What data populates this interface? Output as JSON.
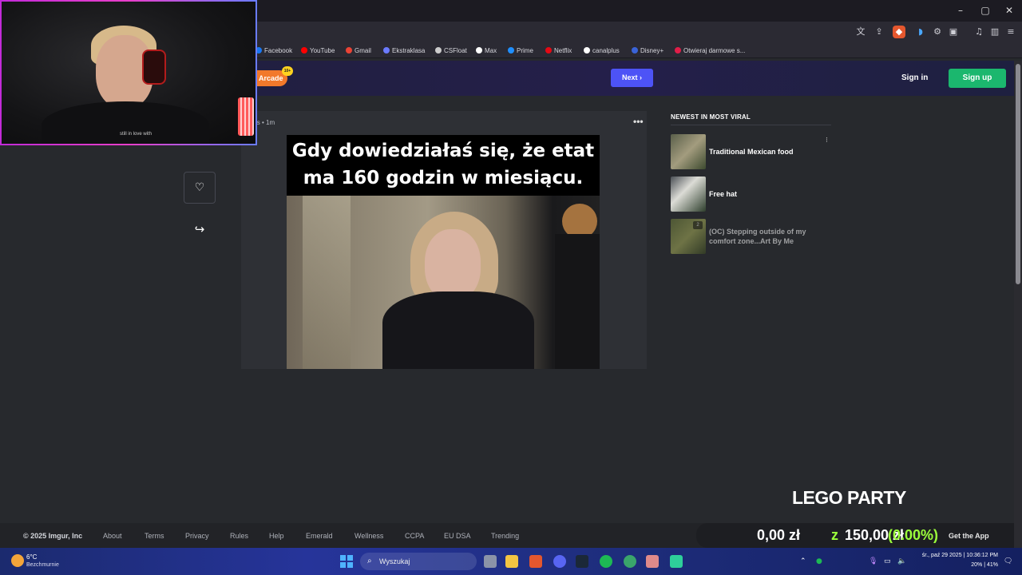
{
  "window": {
    "minimize": "–",
    "maximize": "▢",
    "close": "✕"
  },
  "bookmarks": [
    {
      "label": "Facebook",
      "color": "#1877f2"
    },
    {
      "label": "YouTube",
      "color": "#ff0000"
    },
    {
      "label": "Gmail",
      "color": "#ea4335"
    },
    {
      "label": "Ekstraklasa",
      "color": "#6b7bff"
    },
    {
      "label": "CSFloat",
      "color": "#cccccc"
    },
    {
      "label": "Max",
      "color": "#ffffff"
    },
    {
      "label": "Prime",
      "color": "#1f8fff"
    },
    {
      "label": "Netflix",
      "color": "#e50914"
    },
    {
      "label": "canalplus",
      "color": "#ffffff"
    },
    {
      "label": "Disney+",
      "color": "#1b3a8a"
    },
    {
      "label": "Otwieraj darmowe s...",
      "color": "#e11d48"
    }
  ],
  "header": {
    "arcade": "Arcade",
    "arcade_badge": "10+",
    "next": "Next",
    "sign_in": "Sign in",
    "sign_up": "Sign up"
  },
  "post": {
    "meta": "ws • 1m",
    "more": "•••",
    "caption": "Gdy dowiedziałaś się, że etat ma 160 godzin w miesiącu."
  },
  "sidebar": {
    "title": "NEWEST IN MOST VIRAL",
    "items": [
      {
        "label": "Traditional Mexican food",
        "badge": ""
      },
      {
        "label": "Free hat",
        "badge": ""
      },
      {
        "label": "(OC) Stepping outside of my comfort zone...Art By Me",
        "badge": "2"
      }
    ]
  },
  "footer": {
    "links": [
      "© 2025 Imgur, Inc",
      "About",
      "Terms",
      "Privacy",
      "Rules",
      "Help",
      "Emerald",
      "Wellness",
      "CCPA",
      "EU DSA",
      "Trending"
    ]
  },
  "overlay": {
    "lego_title": "LEGO PARTY",
    "amount_current": "0,00 zł",
    "connector": "z",
    "amount_goal": "150,00 zł",
    "percent": "(0.00%)",
    "get_app": "Get the App"
  },
  "webcam": {
    "shirt_text": "still in love with"
  },
  "taskbar": {
    "weather_temp": "6°C",
    "weather_desc": "Bezchmurnie",
    "search_placeholder": "Wyszukaj",
    "datetime": "śr., paź 29 2025 | 10:36:12 PM",
    "stats": "20% | 41%"
  }
}
